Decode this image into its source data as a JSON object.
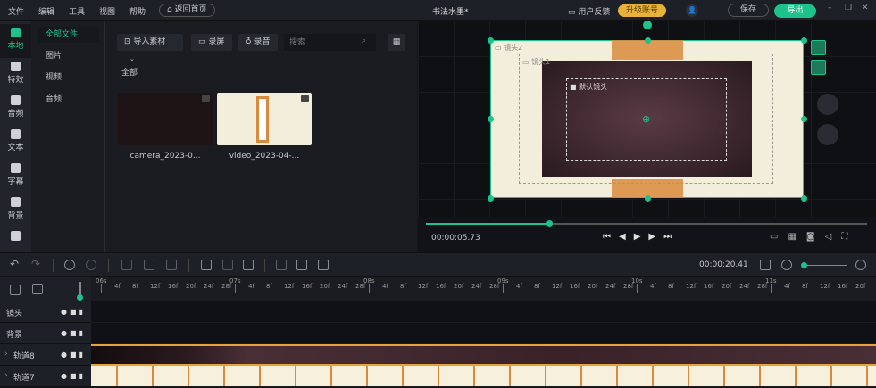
{
  "menu": [
    "文件",
    "编辑",
    "工具",
    "视图",
    "帮助"
  ],
  "home_button": "返回首页",
  "title": "书法水墨*",
  "feedback": "用户反馈",
  "upgrade": "升级账号",
  "save": "保存",
  "export": "导出",
  "colors": {
    "accent": "#1ec28b",
    "upgrade": "#e8b23a"
  },
  "nav": [
    {
      "label": "本地",
      "icon": "local-media-icon"
    },
    {
      "label": "特效",
      "icon": "effects-icon"
    },
    {
      "label": "音频",
      "icon": "music-icon"
    },
    {
      "label": "文本",
      "icon": "text-icon"
    },
    {
      "label": "字幕",
      "icon": "caption-icon"
    },
    {
      "label": "背景",
      "icon": "background-icon"
    },
    {
      "label": "",
      "icon": "puzzle-icon"
    }
  ],
  "sub": [
    "全部文件",
    "图片",
    "视频",
    "音频"
  ],
  "media": {
    "import": "导入素材",
    "record_screen": "录屏",
    "record_audio": "录音",
    "search_placeholder": "搜索",
    "section": "全部",
    "items": [
      {
        "name": "camera_2023-0..."
      },
      {
        "name": "video_2023-04-..."
      }
    ]
  },
  "preview": {
    "lens2": "镜头2",
    "lens1": "镜头1",
    "default_lens": "默认镜头",
    "current_time": "00:00:05.73",
    "progress_pct": 28
  },
  "timeline": {
    "total_time": "00:00:20.41",
    "zoom_pct": 5,
    "seconds": [
      "06s",
      "07s",
      "08s",
      "09s",
      "10s",
      "11s"
    ],
    "frames": [
      "4f",
      "8f",
      "12f",
      "16f",
      "20f",
      "24f",
      "28f"
    ],
    "tracks": [
      {
        "name": "镜头",
        "expandable": false
      },
      {
        "name": "背景",
        "expandable": false
      },
      {
        "name": "轨道8",
        "expandable": true
      },
      {
        "name": "轨道7",
        "expandable": true
      }
    ]
  }
}
